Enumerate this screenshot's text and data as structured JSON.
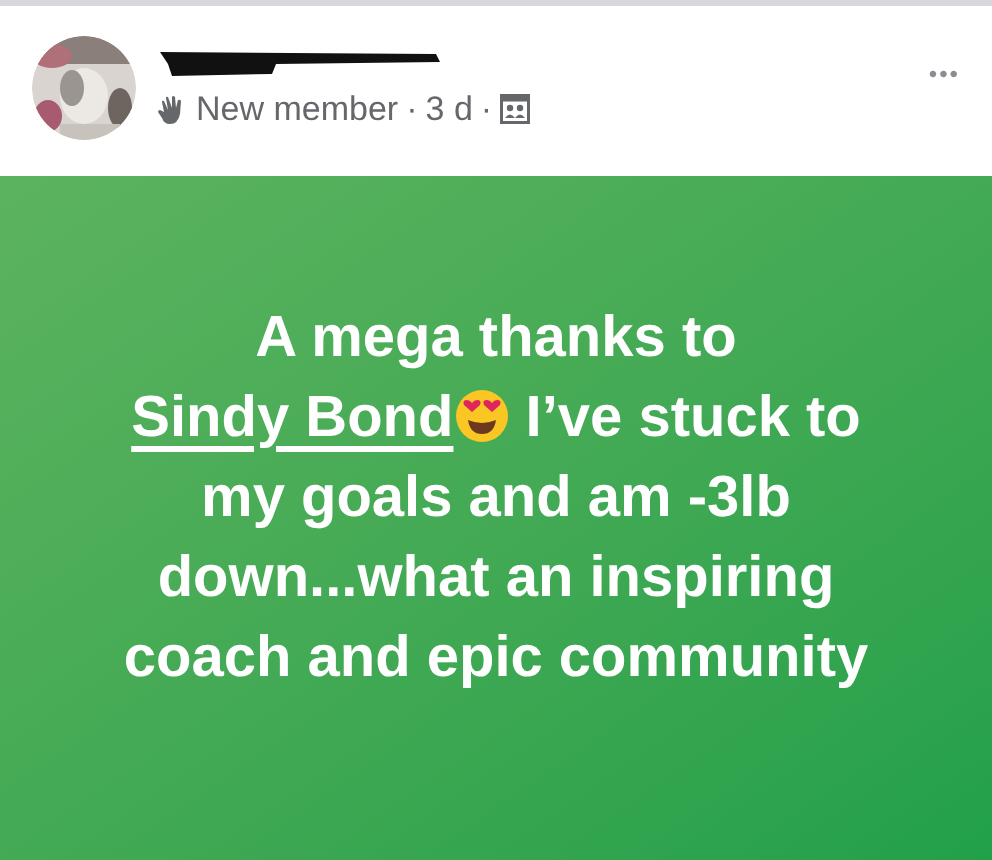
{
  "post": {
    "meta": {
      "badge": "New member",
      "separator": "·",
      "time": "3 d"
    },
    "more": "•••",
    "body": [
      {
        "kind": "text",
        "text": "A mega thanks to "
      },
      {
        "kind": "tag",
        "text": "Sindy Bond"
      },
      {
        "kind": "emoji"
      },
      {
        "kind": "text",
        "text": " I’ve stuck to my goals and am -3lb down...what an inspiring coach and epic community"
      }
    ]
  }
}
